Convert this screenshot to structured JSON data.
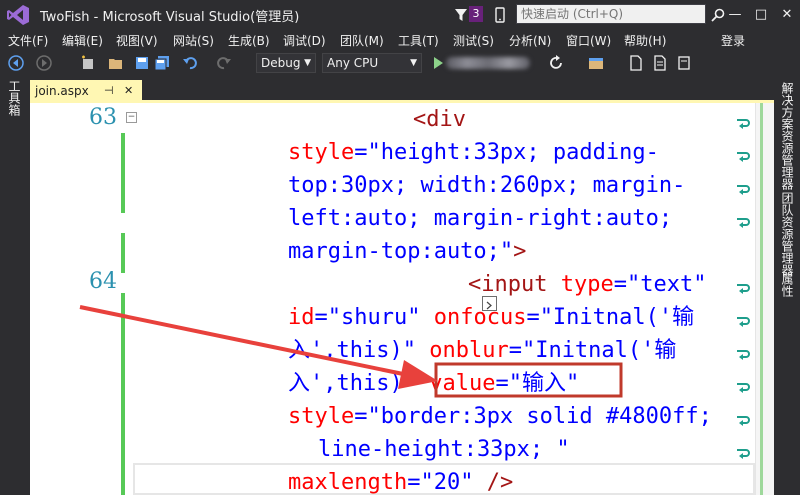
{
  "window": {
    "title": "TwoFish - Microsoft Visual Studio(管理员)",
    "notification_count": "3",
    "quick_launch_placeholder": "快速启动 (Ctrl+Q)",
    "minimize_label": "—",
    "maximize_label": "□",
    "close_label": "✕"
  },
  "menu": {
    "items": [
      "文件(F)",
      "编辑(E)",
      "视图(V)",
      "网站(S)",
      "生成(B)",
      "调试(D)",
      "团队(M)",
      "工具(T)",
      "测试(S)",
      "分析(N)",
      "窗口(W)",
      "帮助(H)"
    ],
    "login": "登录"
  },
  "toolbar": {
    "config": "Debug",
    "platform": "Any CPU"
  },
  "left_panel": {
    "toolbox": "工具箱"
  },
  "right_panel": {
    "solution_explorer": "解决方案资源管理器",
    "team_explorer": "团队资源管理器",
    "properties": "属性"
  },
  "tab": {
    "name": "join.aspx",
    "pin": "⊣",
    "close": "✕"
  },
  "editor": {
    "line_numbers": [
      "63",
      "64"
    ],
    "collapse_glyph": "−",
    "lines": [
      {
        "tag": "<div"
      },
      {
        "attr": "style",
        "eq": "=",
        "val": "\"height:33px; padding-"
      },
      {
        "val": "top:30px; width:260px; margin-"
      },
      {
        "val": "left:auto; margin-right:auto;"
      },
      {
        "val": "margin-top:auto;\"",
        "tag": ">"
      },
      {
        "tag": "<input",
        "attr": "type",
        "eq": "=",
        "val": "\"text\""
      },
      {
        "attr1": "id",
        "eq1": "=",
        "val1": "\"shuru\"",
        "attr2": "onfocus",
        "eq2": "=",
        "val2": "\"Initnal('输"
      },
      {
        "val1": "入',this)\"",
        "attr2": "onblur",
        "eq2": "=",
        "val2": "\"Initnal('输"
      },
      {
        "val1": "入',this)",
        "attr2": "value",
        "eq2": "=",
        "val2": "\"输入\""
      },
      {
        "attr": "style",
        "eq": "=",
        "val": "\"border:3px solid #4800ff;"
      },
      {
        "val": "line-height:33px; \""
      },
      {
        "attr": "maxlength",
        "eq": "=",
        "val": "\"20\"",
        "tag": "/>"
      }
    ]
  },
  "colors": {
    "accent_tab": "#fff7b3",
    "highlight_box": "#c0392b",
    "arrow": "#e8413c",
    "change_bar": "#57c957"
  },
  "icons": [
    "vs-logo-icon",
    "filter-icon",
    "phone-icon",
    "search-icon",
    "back-icon",
    "forward-icon",
    "new-project-icon",
    "open-icon",
    "save-icon",
    "save-all-icon",
    "undo-icon",
    "redo-icon",
    "start-icon",
    "refresh-icon",
    "word-wrap-icon"
  ]
}
